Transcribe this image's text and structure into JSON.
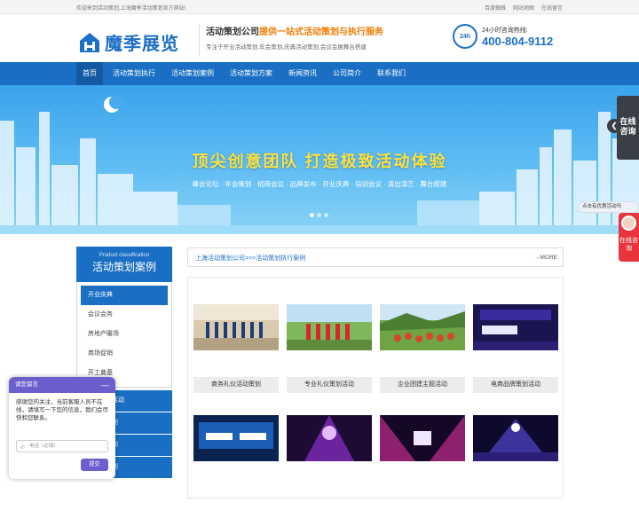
{
  "topbar": {
    "welcome": "欢迎来到活动策划,上海魔季活动策划官方网站!",
    "links": [
      "百度蜘蛛",
      "网站地图",
      "在线留言"
    ]
  },
  "header": {
    "logo_text": "魔季展览",
    "slogan_prefix": "活动策划公司",
    "slogan_highlight": "提供一站式活动策划与执行服务",
    "slogan_sub": "专注于开业活动策划,年会策划,庆典活动策划,会议会展舞台搭建",
    "hotline_label": "24小时咨询热线:",
    "hotline_number": "400-804-9112",
    "hotline_icon_text": "24h"
  },
  "nav": {
    "items": [
      "首页",
      "活动策划执行",
      "活动策划案例",
      "活动策划方案",
      "新闻资讯",
      "公司简介",
      "联系我们"
    ]
  },
  "banner": {
    "headline": "顶尖创意团队  打造极致活动体验",
    "subline": "峰会论坛 · 年会策划 · 招商会议 · 品牌发布 · 开业庆典 · 培训会议 · 演出演艺 · 舞台搭建"
  },
  "sidebar": {
    "title_en": "Product classification",
    "title_cn": "活动策划案例",
    "categories": [
      "开业庆典",
      "会议会务",
      "房地产暖场",
      "商场促销",
      "开工奠基"
    ],
    "lower_items": [
      "活动",
      "划",
      "划",
      "划"
    ]
  },
  "content": {
    "breadcrumb": "上海活动策划公司>>>活动策划执行案例",
    "more": "→MORE",
    "cards": [
      {
        "caption": "商务礼仪活动策划"
      },
      {
        "caption": "专业礼仪策划活动"
      },
      {
        "caption": "企业团建主题活动"
      },
      {
        "caption": "电商品牌策划活动"
      }
    ]
  },
  "float": {
    "online_label": "在线咨询",
    "promo": "点击有优惠活动吗",
    "consult_label": "在线咨询"
  },
  "chat": {
    "title": "请您留言",
    "minimize": "—",
    "message": "感谢您的关注，当前客服人员不在线，请填写一下您的信息，我们会尽快和您联系。",
    "phone_placeholder": "电话（必填）",
    "submit": "提交"
  },
  "colors": {
    "brand_blue": "#1a6fc4",
    "accent_orange": "#f07a00",
    "chat_purple": "#6b5fce",
    "consult_red": "#e8343c"
  }
}
